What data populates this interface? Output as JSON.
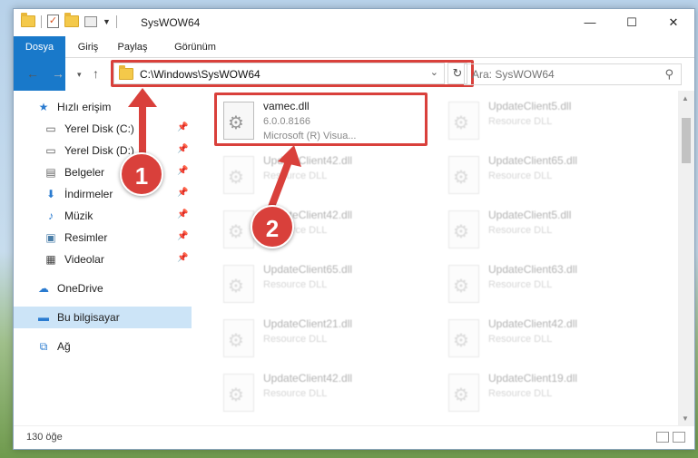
{
  "window": {
    "title": "SysWOW64"
  },
  "ribbon": {
    "tabs": [
      "Dosya",
      "Giriş",
      "Paylaş",
      "Görünüm"
    ]
  },
  "address": {
    "path": "C:\\Windows\\SysWOW64"
  },
  "search": {
    "placeholder": "Ara: SysWOW64"
  },
  "sidebar": {
    "items": [
      {
        "label": "Hızlı erişim",
        "icon": "star-icon"
      },
      {
        "label": "Yerel Disk (C:)",
        "icon": "drive-icon"
      },
      {
        "label": "Yerel Disk (D:)",
        "icon": "drive-icon"
      },
      {
        "label": "Belgeler",
        "icon": "documents-icon"
      },
      {
        "label": "İndirmeler",
        "icon": "download-icon"
      },
      {
        "label": "Müzik",
        "icon": "music-icon"
      },
      {
        "label": "Resimler",
        "icon": "pictures-icon"
      },
      {
        "label": "Videolar",
        "icon": "videos-icon"
      },
      {
        "label": "OneDrive",
        "icon": "cloud-icon"
      },
      {
        "label": "Bu bilgisayar",
        "icon": "computer-icon"
      },
      {
        "label": "Ağ",
        "icon": "network-icon"
      }
    ]
  },
  "files": {
    "highlighted": {
      "name": "vamec.dll",
      "type": "6.0.0.8166",
      "desc": "Microsoft (R) Visua..."
    },
    "left": [
      {
        "name": "UpdateClient42.dll",
        "desc": "Resource DLL"
      },
      {
        "name": "UpdateClient42.dll",
        "desc": "Resource DLL"
      },
      {
        "name": "UpdateClient65.dll",
        "desc": "Resource DLL"
      },
      {
        "name": "UpdateClient21.dll",
        "desc": "Resource DLL"
      },
      {
        "name": "UpdateClient42.dll",
        "desc": "Resource DLL"
      }
    ],
    "right": [
      {
        "name": "UpdateClient5.dll",
        "desc": "Resource DLL"
      },
      {
        "name": "UpdateClient65.dll",
        "desc": "Resource DLL"
      },
      {
        "name": "UpdateClient5.dll",
        "desc": "Resource DLL"
      },
      {
        "name": "UpdateClient63.dll",
        "desc": "Resource DLL"
      },
      {
        "name": "UpdateClient42.dll",
        "desc": "Resource DLL"
      },
      {
        "name": "UpdateClient19.dll",
        "desc": "Resource DLL"
      }
    ]
  },
  "status": {
    "count": "130 öğe"
  },
  "annotations": {
    "step1": "1",
    "step2": "2",
    "color": "#d9403b"
  }
}
